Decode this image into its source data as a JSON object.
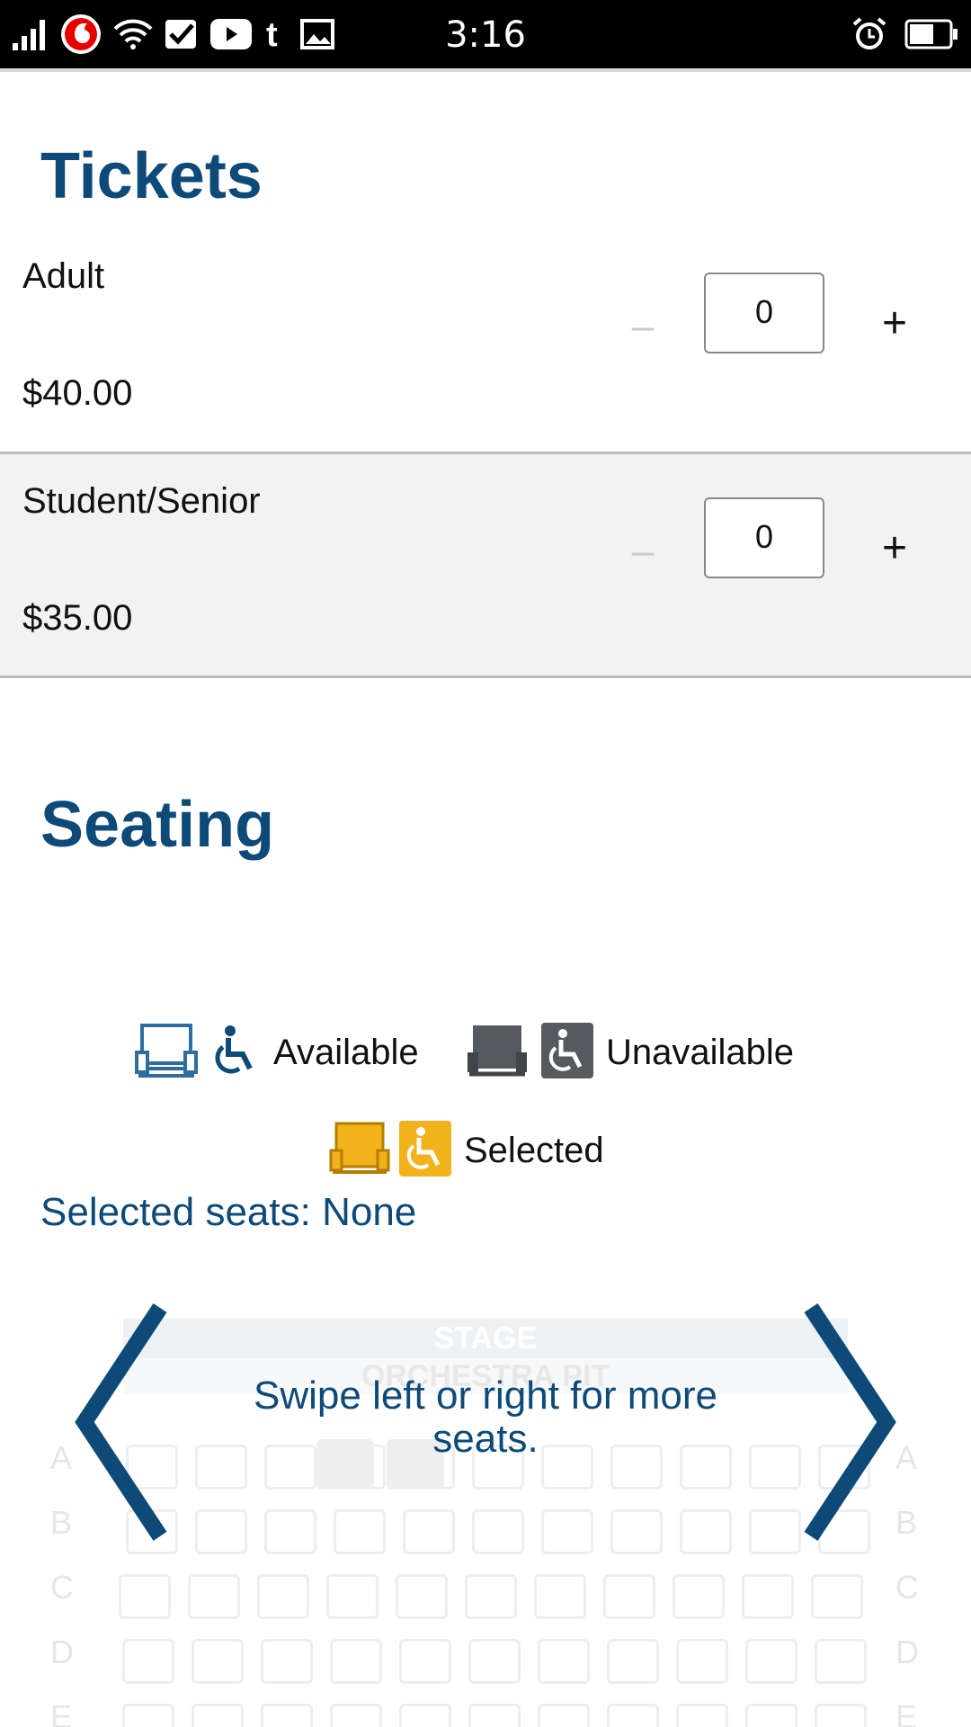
{
  "status_bar": {
    "time": "3:16",
    "icons_left": [
      "signal-icon",
      "vodafone-icon",
      "wifi-icon",
      "check-app-icon",
      "youtube-icon",
      "tumblr-icon",
      "image-icon"
    ],
    "icons_right": [
      "alarm-icon",
      "battery-icon"
    ]
  },
  "tickets": {
    "title": "Tickets",
    "items": [
      {
        "name": "Adult",
        "price": "$40.00",
        "quantity": "0",
        "minus": "–",
        "plus": "+"
      },
      {
        "name": "Student/Senior",
        "price": "$35.00",
        "quantity": "0",
        "minus": "–",
        "plus": "+"
      }
    ]
  },
  "seating": {
    "title": "Seating",
    "legend": {
      "available": "Available",
      "unavailable": "Unavailable",
      "selected": "Selected"
    },
    "selected_seats_label": "Selected seats: None",
    "map": {
      "stage": "STAGE",
      "orchestra_pit": "ORCHESTRA PIT",
      "swipe_hint": "Swipe left or right for more seats.",
      "rows": [
        "A",
        "B",
        "C",
        "D",
        "E"
      ]
    }
  },
  "colors": {
    "brand_blue": "#0d4a78",
    "selected_gold": "#f2b21c",
    "unavailable_gray": "#555a5e"
  }
}
